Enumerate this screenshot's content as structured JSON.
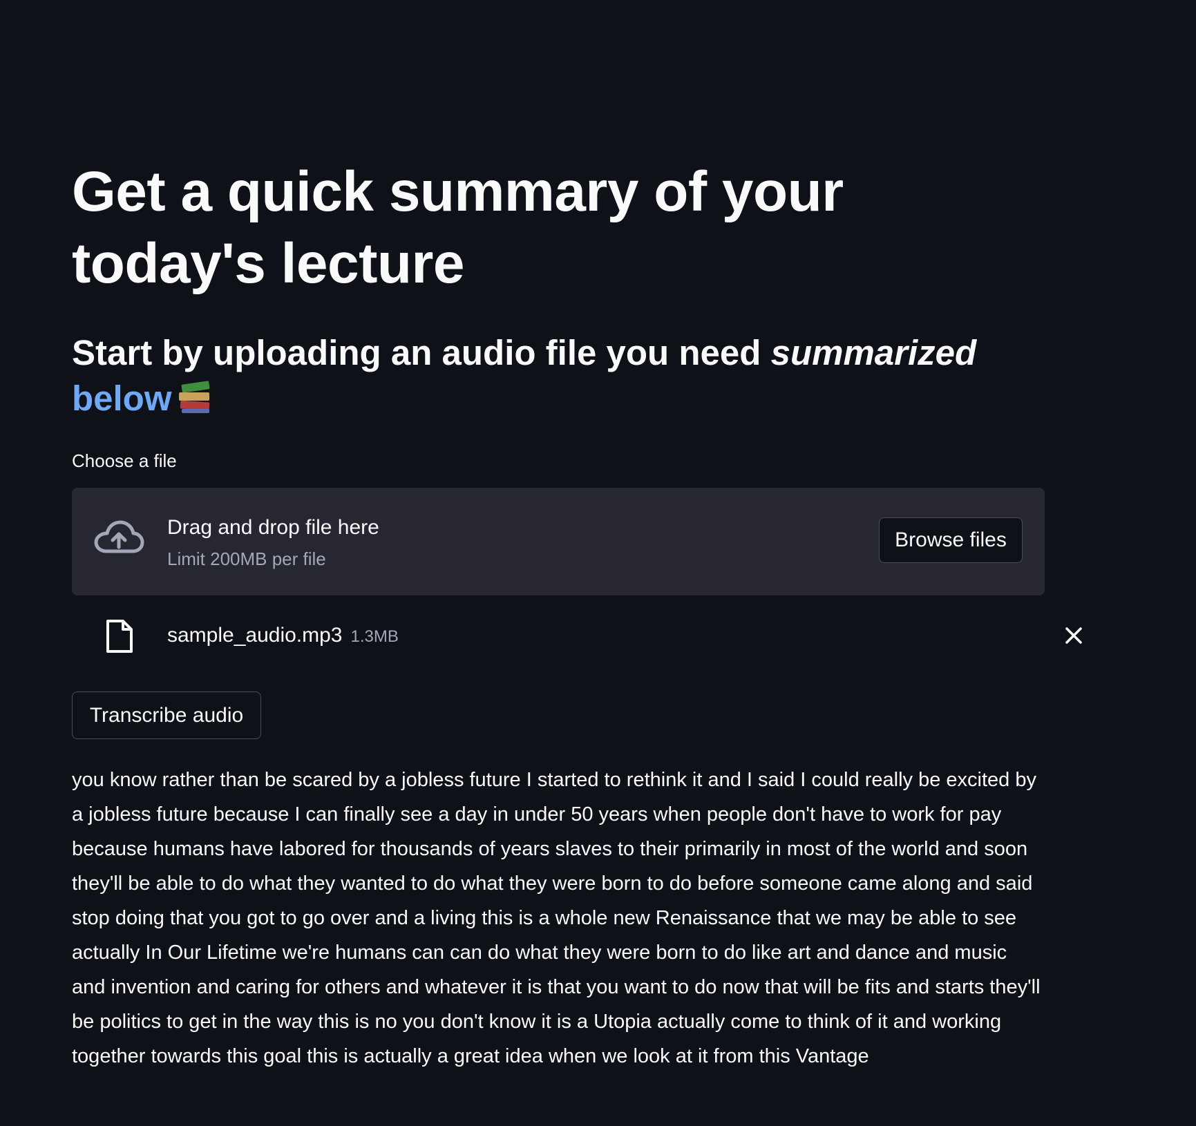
{
  "header": {
    "title": "Get a quick summary of your today's lecture"
  },
  "subheader": {
    "text_plain": "Start by uploading an audio file you need ",
    "text_italic": "summarized",
    "text_blue": "below",
    "icon": "books-icon"
  },
  "uploader": {
    "label": "Choose a file",
    "drop_text": "Drag and drop file here",
    "limit_text": "Limit 200MB per file",
    "browse_label": "Browse files",
    "icon": "cloud-upload-icon"
  },
  "uploaded_file": {
    "name": "sample_audio.mp3",
    "size": "1.3MB",
    "icon": "file-icon",
    "remove_icon": "close-icon"
  },
  "actions": {
    "transcribe_label": "Transcribe audio"
  },
  "transcript": {
    "text": "you know rather than be scared by a jobless future I started to rethink it and I said I could really be excited by a jobless future because I can finally see a day in under 50 years when people don't have to work for pay because humans have labored for thousands of years slaves to their primarily in most of the world and soon they'll be able to do what they wanted to do what they were born to do before someone came along and said stop doing that you got to go over and a living this is a whole new Renaissance that we may be able to see actually In Our Lifetime we're humans can can do what they were born to do like art and dance and music and invention and caring for others and whatever it is that you want to do now that will be fits and starts they'll be politics to get in the way this is no you don't know it is a Utopia actually come to think of it and working together towards this goal this is actually a great idea when we look at it from this Vantage"
  },
  "colors": {
    "background": "#0e1117",
    "panel": "#262730",
    "text": "#fafafa",
    "muted": "#a3a8b8",
    "accent_blue": "#6fa8f5",
    "border": "#4b4e5a"
  }
}
